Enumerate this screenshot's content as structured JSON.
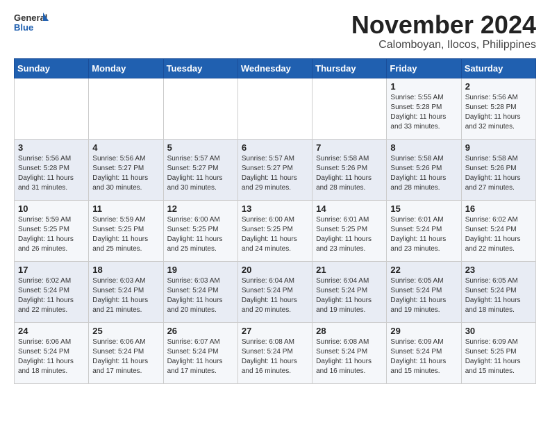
{
  "logo": {
    "general": "General",
    "blue": "Blue"
  },
  "header": {
    "month": "November 2024",
    "location": "Calomboyan, Ilocos, Philippines"
  },
  "weekdays": [
    "Sunday",
    "Monday",
    "Tuesday",
    "Wednesday",
    "Thursday",
    "Friday",
    "Saturday"
  ],
  "weeks": [
    [
      {
        "day": "",
        "info": ""
      },
      {
        "day": "",
        "info": ""
      },
      {
        "day": "",
        "info": ""
      },
      {
        "day": "",
        "info": ""
      },
      {
        "day": "",
        "info": ""
      },
      {
        "day": "1",
        "info": "Sunrise: 5:55 AM\nSunset: 5:28 PM\nDaylight: 11 hours\nand 33 minutes."
      },
      {
        "day": "2",
        "info": "Sunrise: 5:56 AM\nSunset: 5:28 PM\nDaylight: 11 hours\nand 32 minutes."
      }
    ],
    [
      {
        "day": "3",
        "info": "Sunrise: 5:56 AM\nSunset: 5:28 PM\nDaylight: 11 hours\nand 31 minutes."
      },
      {
        "day": "4",
        "info": "Sunrise: 5:56 AM\nSunset: 5:27 PM\nDaylight: 11 hours\nand 30 minutes."
      },
      {
        "day": "5",
        "info": "Sunrise: 5:57 AM\nSunset: 5:27 PM\nDaylight: 11 hours\nand 30 minutes."
      },
      {
        "day": "6",
        "info": "Sunrise: 5:57 AM\nSunset: 5:27 PM\nDaylight: 11 hours\nand 29 minutes."
      },
      {
        "day": "7",
        "info": "Sunrise: 5:58 AM\nSunset: 5:26 PM\nDaylight: 11 hours\nand 28 minutes."
      },
      {
        "day": "8",
        "info": "Sunrise: 5:58 AM\nSunset: 5:26 PM\nDaylight: 11 hours\nand 28 minutes."
      },
      {
        "day": "9",
        "info": "Sunrise: 5:58 AM\nSunset: 5:26 PM\nDaylight: 11 hours\nand 27 minutes."
      }
    ],
    [
      {
        "day": "10",
        "info": "Sunrise: 5:59 AM\nSunset: 5:25 PM\nDaylight: 11 hours\nand 26 minutes."
      },
      {
        "day": "11",
        "info": "Sunrise: 5:59 AM\nSunset: 5:25 PM\nDaylight: 11 hours\nand 25 minutes."
      },
      {
        "day": "12",
        "info": "Sunrise: 6:00 AM\nSunset: 5:25 PM\nDaylight: 11 hours\nand 25 minutes."
      },
      {
        "day": "13",
        "info": "Sunrise: 6:00 AM\nSunset: 5:25 PM\nDaylight: 11 hours\nand 24 minutes."
      },
      {
        "day": "14",
        "info": "Sunrise: 6:01 AM\nSunset: 5:25 PM\nDaylight: 11 hours\nand 23 minutes."
      },
      {
        "day": "15",
        "info": "Sunrise: 6:01 AM\nSunset: 5:24 PM\nDaylight: 11 hours\nand 23 minutes."
      },
      {
        "day": "16",
        "info": "Sunrise: 6:02 AM\nSunset: 5:24 PM\nDaylight: 11 hours\nand 22 minutes."
      }
    ],
    [
      {
        "day": "17",
        "info": "Sunrise: 6:02 AM\nSunset: 5:24 PM\nDaylight: 11 hours\nand 22 minutes."
      },
      {
        "day": "18",
        "info": "Sunrise: 6:03 AM\nSunset: 5:24 PM\nDaylight: 11 hours\nand 21 minutes."
      },
      {
        "day": "19",
        "info": "Sunrise: 6:03 AM\nSunset: 5:24 PM\nDaylight: 11 hours\nand 20 minutes."
      },
      {
        "day": "20",
        "info": "Sunrise: 6:04 AM\nSunset: 5:24 PM\nDaylight: 11 hours\nand 20 minutes."
      },
      {
        "day": "21",
        "info": "Sunrise: 6:04 AM\nSunset: 5:24 PM\nDaylight: 11 hours\nand 19 minutes."
      },
      {
        "day": "22",
        "info": "Sunrise: 6:05 AM\nSunset: 5:24 PM\nDaylight: 11 hours\nand 19 minutes."
      },
      {
        "day": "23",
        "info": "Sunrise: 6:05 AM\nSunset: 5:24 PM\nDaylight: 11 hours\nand 18 minutes."
      }
    ],
    [
      {
        "day": "24",
        "info": "Sunrise: 6:06 AM\nSunset: 5:24 PM\nDaylight: 11 hours\nand 18 minutes."
      },
      {
        "day": "25",
        "info": "Sunrise: 6:06 AM\nSunset: 5:24 PM\nDaylight: 11 hours\nand 17 minutes."
      },
      {
        "day": "26",
        "info": "Sunrise: 6:07 AM\nSunset: 5:24 PM\nDaylight: 11 hours\nand 17 minutes."
      },
      {
        "day": "27",
        "info": "Sunrise: 6:08 AM\nSunset: 5:24 PM\nDaylight: 11 hours\nand 16 minutes."
      },
      {
        "day": "28",
        "info": "Sunrise: 6:08 AM\nSunset: 5:24 PM\nDaylight: 11 hours\nand 16 minutes."
      },
      {
        "day": "29",
        "info": "Sunrise: 6:09 AM\nSunset: 5:24 PM\nDaylight: 11 hours\nand 15 minutes."
      },
      {
        "day": "30",
        "info": "Sunrise: 6:09 AM\nSunset: 5:25 PM\nDaylight: 11 hours\nand 15 minutes."
      }
    ]
  ]
}
